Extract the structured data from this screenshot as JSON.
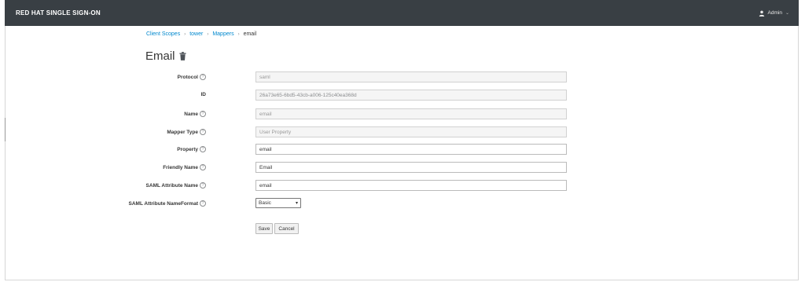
{
  "header": {
    "brand": "RED HAT SINGLE SIGN-ON",
    "user_label": "Admin",
    "user_icon": "user-icon",
    "dropdown_icon": "chevron-down-icon"
  },
  "breadcrumb": {
    "items": [
      "Client Scopes",
      "tower",
      "Mappers"
    ],
    "current": "email",
    "separator": "›"
  },
  "page": {
    "title": "Email",
    "delete_icon": "trash-icon"
  },
  "form": {
    "protocol": {
      "label": "Protocol",
      "value": "saml"
    },
    "id": {
      "label": "ID",
      "value": "26a73e65-6bd5-43cb-a006-125c40ea368d"
    },
    "name": {
      "label": "Name",
      "value": "email"
    },
    "mapper_type": {
      "label": "Mapper Type",
      "value": "User Property"
    },
    "property": {
      "label": "Property",
      "value": "email"
    },
    "friendly_name": {
      "label": "Friendly Name",
      "value": "Email"
    },
    "saml_attribute_name": {
      "label": "SAML Attribute Name",
      "value": "email"
    },
    "saml_attribute_nameformat": {
      "label": "SAML Attribute NameFormat",
      "value": "Basic"
    }
  },
  "buttons": {
    "save": "Save",
    "cancel": "Cancel"
  },
  "colors": {
    "topbar": "#393f44",
    "link": "#0088ce"
  }
}
